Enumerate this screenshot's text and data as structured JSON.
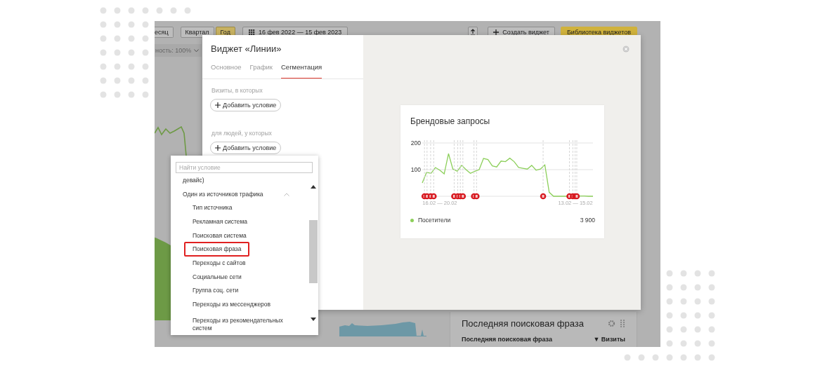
{
  "background_app": {
    "periods": [
      {
        "label": "есяц",
        "selected": false
      },
      {
        "label": "Квартал",
        "selected": false
      },
      {
        "label": "Год",
        "selected": true
      }
    ],
    "date_range": "16 фев 2022 — 15 фев 2023",
    "create_widget": "Создать виджет",
    "widget_library": "Библиотека виджетов",
    "accuracy": "ность: 100%",
    "widget": {
      "title": "Последняя поисковая фраза",
      "columns": [
        "Последняя поисковая фраза",
        "▼ Визиты"
      ]
    }
  },
  "modal": {
    "title": "Виджет «Линии»",
    "tabs": [
      {
        "label": "Основное",
        "selected": false
      },
      {
        "label": "График",
        "selected": false
      },
      {
        "label": "Сегментация",
        "selected": true
      }
    ],
    "sections": [
      {
        "label": "Визиты, в которых",
        "button": "Добавить условие"
      },
      {
        "label": "для людей, у которых",
        "button": "Добавить условие"
      }
    ],
    "preview": {
      "title": "Брендовые запросы",
      "chart_data": {
        "type": "line",
        "grid": true,
        "ylim": [
          0,
          200
        ],
        "yticks": [
          {
            "value": 100,
            "label": "100"
          },
          {
            "value": 200,
            "label": "200"
          }
        ],
        "categories": [
          null,
          null,
          null,
          null,
          "16.02 — 20.02",
          null,
          null,
          null,
          null,
          null,
          null,
          null,
          null,
          null,
          null,
          null,
          null,
          null,
          null,
          null,
          null,
          null,
          null,
          null,
          null,
          null,
          null,
          null,
          null,
          null,
          null,
          null,
          null,
          null,
          null,
          "13.02 — 15.02",
          null,
          null,
          null,
          null
        ],
        "series": [
          {
            "name": "Посетители",
            "color": "#8ccf5a",
            "values": [
              50,
              90,
              86,
              108,
              98,
              84,
              160,
              102,
              94,
              116,
              100,
              86,
              94,
              100,
              142,
              138,
              114,
              110,
              132,
              130,
              143,
              130,
              108,
              105,
              102,
              116,
              98,
              102,
              118,
              15,
              0,
              0,
              0,
              0,
              0,
              0,
              1,
              1,
              0,
              0
            ]
          }
        ]
      },
      "legend_values": [
        "3 900"
      ]
    }
  },
  "condition_picker": {
    "placeholder": "Найти условие",
    "items": [
      {
        "label": "девайс)"
      },
      {
        "label": "Один из источников трафика",
        "expanded": true,
        "children": [
          {
            "label": "Тип источника",
            "highlighted": false
          },
          {
            "label": "Рекламная система",
            "highlighted": false
          },
          {
            "label": "Поисковая система",
            "highlighted": false
          },
          {
            "label": "Поисковая фраза",
            "highlighted": true
          },
          {
            "label": "Переходы с сайтов",
            "highlighted": false
          },
          {
            "label": "Социальные сети",
            "highlighted": false
          },
          {
            "label": "Группа соц. сети",
            "highlighted": false
          },
          {
            "label": "Переходы из мессенджеров",
            "highlighted": false
          },
          {
            "label": "Переходы из рекомендательных систем",
            "highlighted": false
          }
        ]
      }
    ]
  }
}
